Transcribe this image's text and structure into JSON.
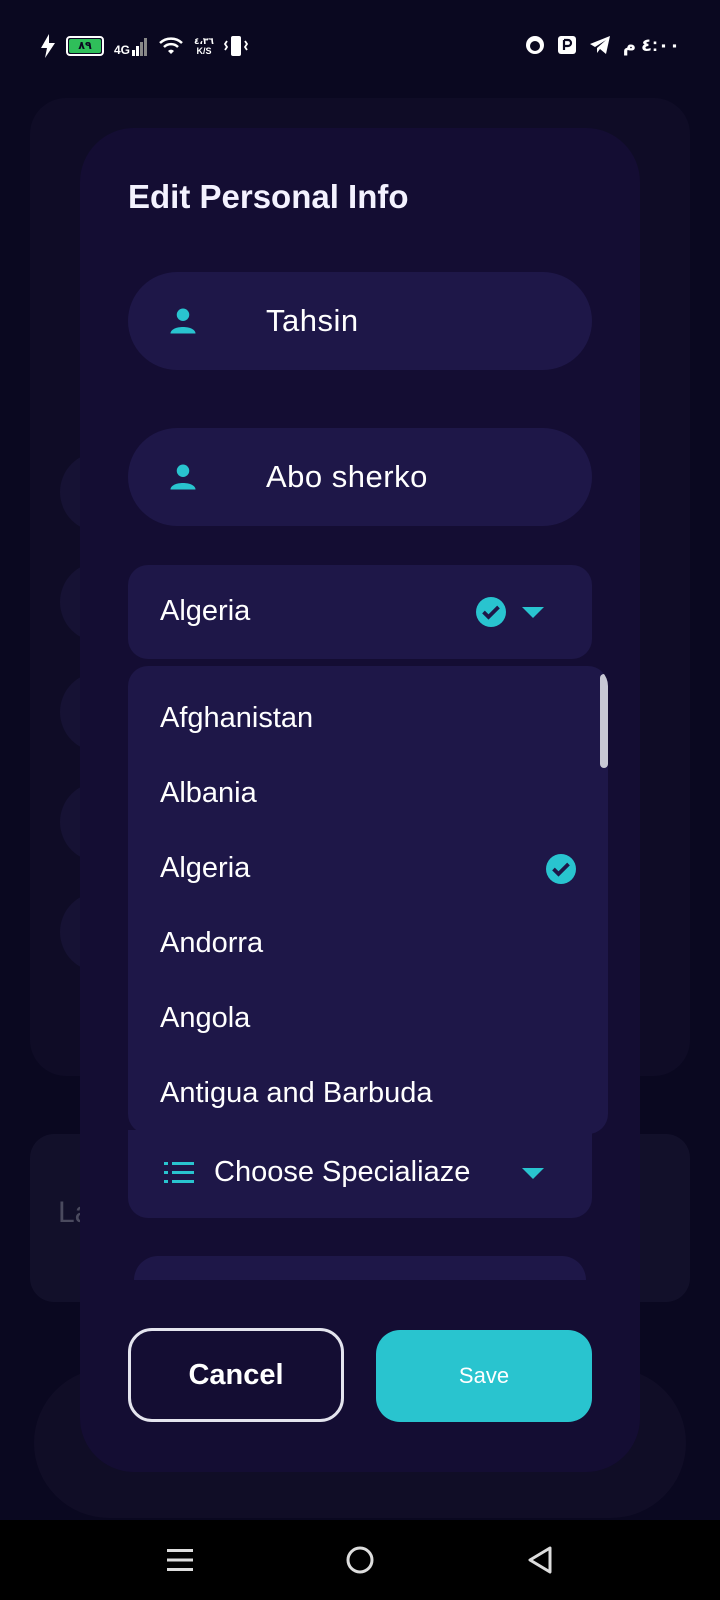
{
  "status_bar": {
    "battery": "٨٩",
    "network": "4G",
    "speed_value": "٤،٣٦",
    "speed_unit": "K/S",
    "time": "٤:٠٠ م"
  },
  "background": {
    "partial_text": "La"
  },
  "dialog": {
    "title": "Edit Personal Info",
    "first_name": "Tahsin",
    "last_name": "Abo sherko",
    "country": {
      "selected": "Algeria",
      "options": [
        "Afghanistan",
        "Albania",
        "Algeria",
        "Andorra",
        "Angola",
        "Antigua and Barbuda"
      ]
    },
    "specialty_placeholder": "Choose Specialiaze",
    "cancel_label": "Cancel",
    "save_label": "Save"
  },
  "colors": {
    "accent": "#29c4cf",
    "dialog_bg": "#140d33",
    "field_bg": "#1e1748",
    "page_bg": "#0a0820"
  },
  "icons": {
    "name_field": "person-icon",
    "selected": "check-circle-icon",
    "dropdown": "caret-down-icon",
    "specialty": "list-icon",
    "nav": [
      "menu-icon",
      "home-icon",
      "back-icon"
    ]
  }
}
